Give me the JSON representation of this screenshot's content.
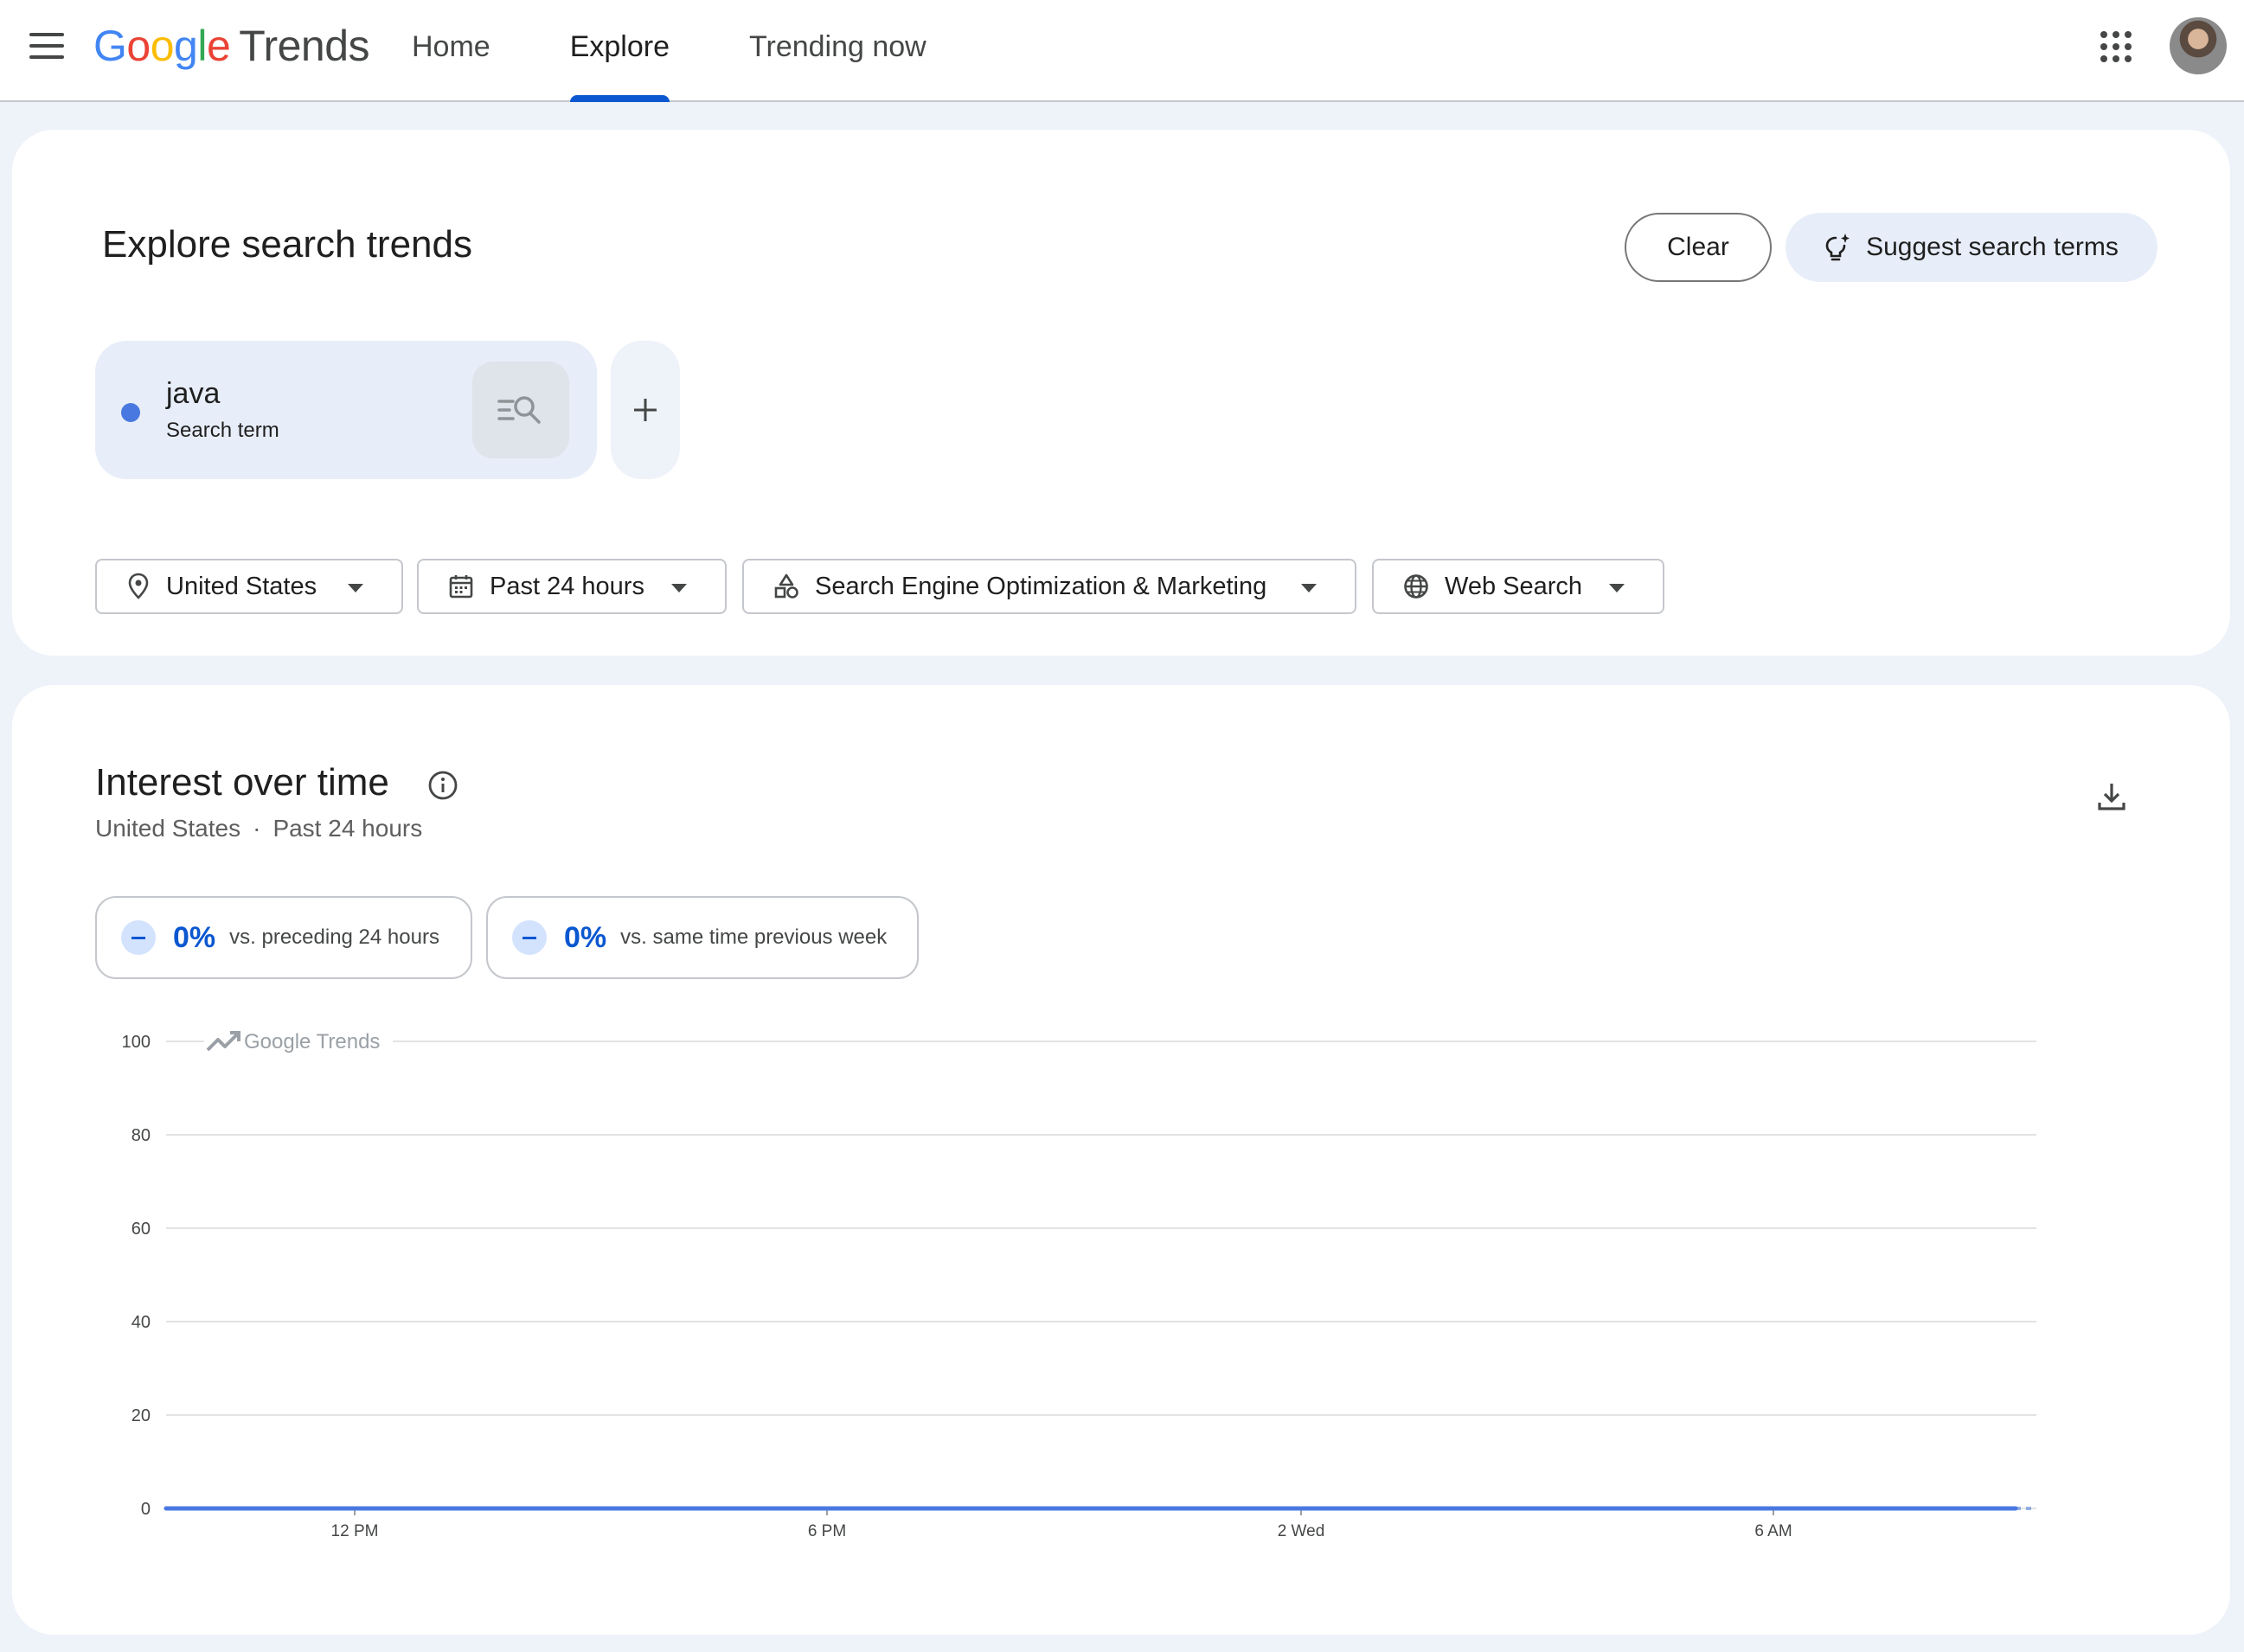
{
  "header": {
    "logo_letters": [
      "G",
      "o",
      "o",
      "g",
      "l",
      "e"
    ],
    "product": "Trends",
    "tabs": [
      {
        "label": "Home",
        "active": false
      },
      {
        "label": "Explore",
        "active": true
      },
      {
        "label": "Trending now",
        "active": false
      }
    ]
  },
  "explore": {
    "title": "Explore search trends",
    "clear_label": "Clear",
    "suggest_label": "Suggest search terms",
    "term": {
      "name": "java",
      "type": "Search term",
      "color": "#4979e0"
    },
    "filters": {
      "location": "United States",
      "time": "Past 24 hours",
      "category": "Search Engine Optimization & Marketing",
      "property": "Web Search"
    }
  },
  "interest": {
    "title": "Interest over time",
    "subtitle_location": "United States",
    "subtitle_separator": "·",
    "subtitle_time": "Past 24 hours",
    "stats": [
      {
        "value": "0%",
        "label": "vs. preceding 24 hours"
      },
      {
        "value": "0%",
        "label": "vs. same time previous week"
      }
    ]
  },
  "chart_data": {
    "type": "line",
    "title": "",
    "watermark": "Google Trends",
    "ylim": [
      0,
      100
    ],
    "yticks": [
      "0",
      "20",
      "40",
      "60",
      "80",
      "100"
    ],
    "xticks": [
      "12 PM",
      "6 PM",
      "2 Wed",
      "6 AM"
    ],
    "grid": true,
    "series": [
      {
        "name": "java",
        "color": "#4979e0",
        "values": [
          0,
          0,
          0,
          0,
          0,
          0,
          0,
          0,
          0,
          0,
          0,
          0,
          0,
          0,
          0,
          0,
          0,
          0,
          0,
          0,
          0,
          0,
          0,
          0,
          0
        ]
      }
    ]
  }
}
